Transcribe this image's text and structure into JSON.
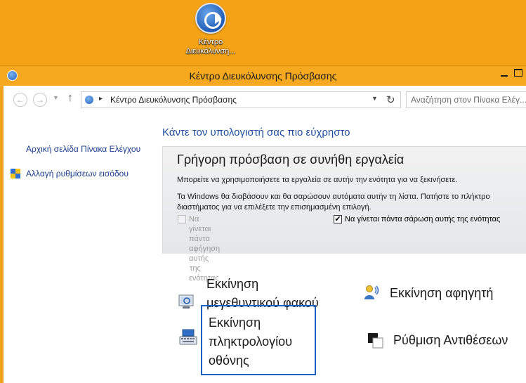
{
  "desktop": {
    "icon_label_line1": "Κέντρο",
    "icon_label_line2": "Διευκόλυνση..."
  },
  "window": {
    "title": "Κέντρο Διευκόλυνσης Πρόσβασης"
  },
  "addressbar": {
    "back": "←",
    "forward": "→",
    "recent": "▼",
    "up": "↑",
    "separator": "▸",
    "breadcrumb": "Κέντρο Διευκόλυνσης Πρόσβασης",
    "dropdown": "▼",
    "refresh": "↻",
    "search_placeholder": "Αναζήτηση στον Πίνακα Ελέγ..."
  },
  "sidebar": {
    "items": [
      {
        "label": "Αρχική σελίδα Πίνακα Ελέγχου"
      },
      {
        "label": "Αλλαγή ρυθμίσεων εισόδου",
        "icon": "shield-icon"
      }
    ]
  },
  "main": {
    "heading": "Κάντε τον υπολογιστή σας πιο εύχρηστο",
    "quick_access": {
      "title": "Γρήγορη πρόσβαση σε συνήθη εργαλεία",
      "desc1": "Μπορείτε να χρησιμοποιήσετε τα εργαλεία σε αυτήν την ενότητα για να ξεκινήσετε.",
      "desc2": "Τα Windows θα διαβάσουν και θα σαρώσουν αυτόματα αυτήν τη λίστα. Πατήστε το πλήκτρο διαστήματος για να επιλέξετε την επισημασμένη επιλογή.",
      "checkbox_read_line1": "Να γίνεται πάντα αφήγηση αυτής",
      "checkbox_read_line2": "της ενότητας",
      "checkbox_read_checked": false,
      "checkbox_scan": "Να γίνεται πάντα σάρωση αυτής της ενότητας",
      "checkbox_scan_checked": true,
      "check_mark": "✔"
    },
    "tools": {
      "magnifier_line1": "Εκκίνηση",
      "magnifier_line2": "μεγεθυντικού φακού",
      "narrator": "Εκκίνηση αφηγητή",
      "keyboard_line1": "Εκκίνηση",
      "keyboard_line2": "πληκτρολογίου",
      "keyboard_line3": "οθόνης",
      "contrast": "Ρύθμιση Αντιθέσεων"
    }
  },
  "colors": {
    "desktop_bg": "#f4a316",
    "link": "#1b3d8a",
    "heading": "#1e4e9d",
    "focus": "#1861c4"
  }
}
